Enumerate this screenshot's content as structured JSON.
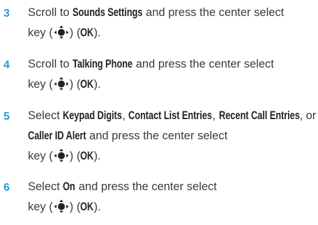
{
  "steps": [
    {
      "number": "3",
      "lines": [
        [
          "Scroll to ",
          {
            "term": "Sounds Settings"
          },
          " and press the center select"
        ],
        [
          "key (",
          {
            "icon": "nav-key-icon"
          },
          ") (",
          {
            "term": "OK"
          },
          ")."
        ]
      ]
    },
    {
      "number": "4",
      "lines": [
        [
          "Scroll to ",
          {
            "term": "Talking Phone"
          },
          " and press the center select"
        ],
        [
          "key (",
          {
            "icon": "nav-key-icon"
          },
          ") (",
          {
            "term": "OK"
          },
          ")."
        ]
      ]
    },
    {
      "number": "5",
      "lines": [
        [
          "Select ",
          {
            "term": "Keypad Digits"
          },
          ", ",
          {
            "term": "Contact List Entries"
          },
          ", ",
          {
            "term": "Recent Call Entries"
          },
          ", or"
        ],
        [
          {
            "term": "Caller ID Alert"
          },
          " and press the center select"
        ],
        [
          "key (",
          {
            "icon": "nav-key-icon"
          },
          ") (",
          {
            "term": "OK"
          },
          ")."
        ]
      ]
    },
    {
      "number": "6",
      "lines": [
        [
          "Select ",
          {
            "term": "On"
          },
          " and press the center select"
        ],
        [
          "key (",
          {
            "icon": "nav-key-icon"
          },
          ") (",
          {
            "term": "OK"
          },
          ")."
        ]
      ]
    }
  ]
}
